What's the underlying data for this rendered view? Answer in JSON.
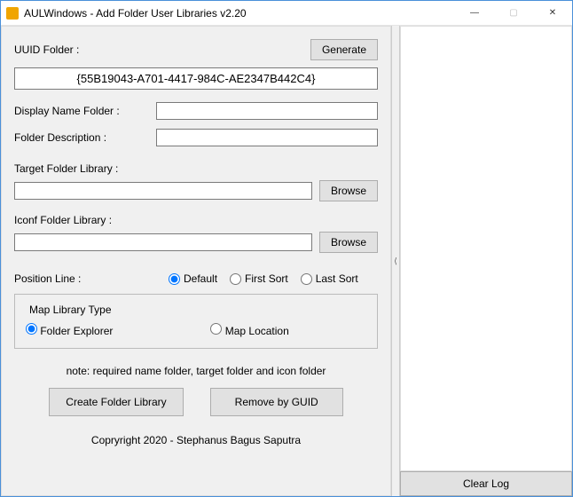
{
  "window": {
    "title": "AULWindows - Add Folder User Libraries v2.20"
  },
  "labels": {
    "uuid": "UUID Folder   :",
    "display_name": "Display Name Folder   :",
    "description": "Folder Description      :",
    "target": "Target Folder Library   :",
    "iconf": "Iconf Folder Library    :",
    "position": "Position Line           :",
    "map_type": "Map Library Type"
  },
  "buttons": {
    "generate": "Generate",
    "browse": "Browse",
    "create": "Create Folder Library",
    "remove": "Remove by GUID",
    "clear_log": "Clear Log"
  },
  "values": {
    "uuid": "{55B19043-A701-4417-984C-AE2347B442C4}",
    "display_name": "",
    "description": "",
    "target": "",
    "iconf": ""
  },
  "radios": {
    "default": "Default",
    "first_sort": "First Sort",
    "last_sort": "Last Sort",
    "folder_explorer": "Folder Explorer",
    "map_location": "Map Location"
  },
  "note": "note: required name folder, target folder and  icon folder",
  "copyright": "Copryright 2020 - Stephanus Bagus Saputra"
}
